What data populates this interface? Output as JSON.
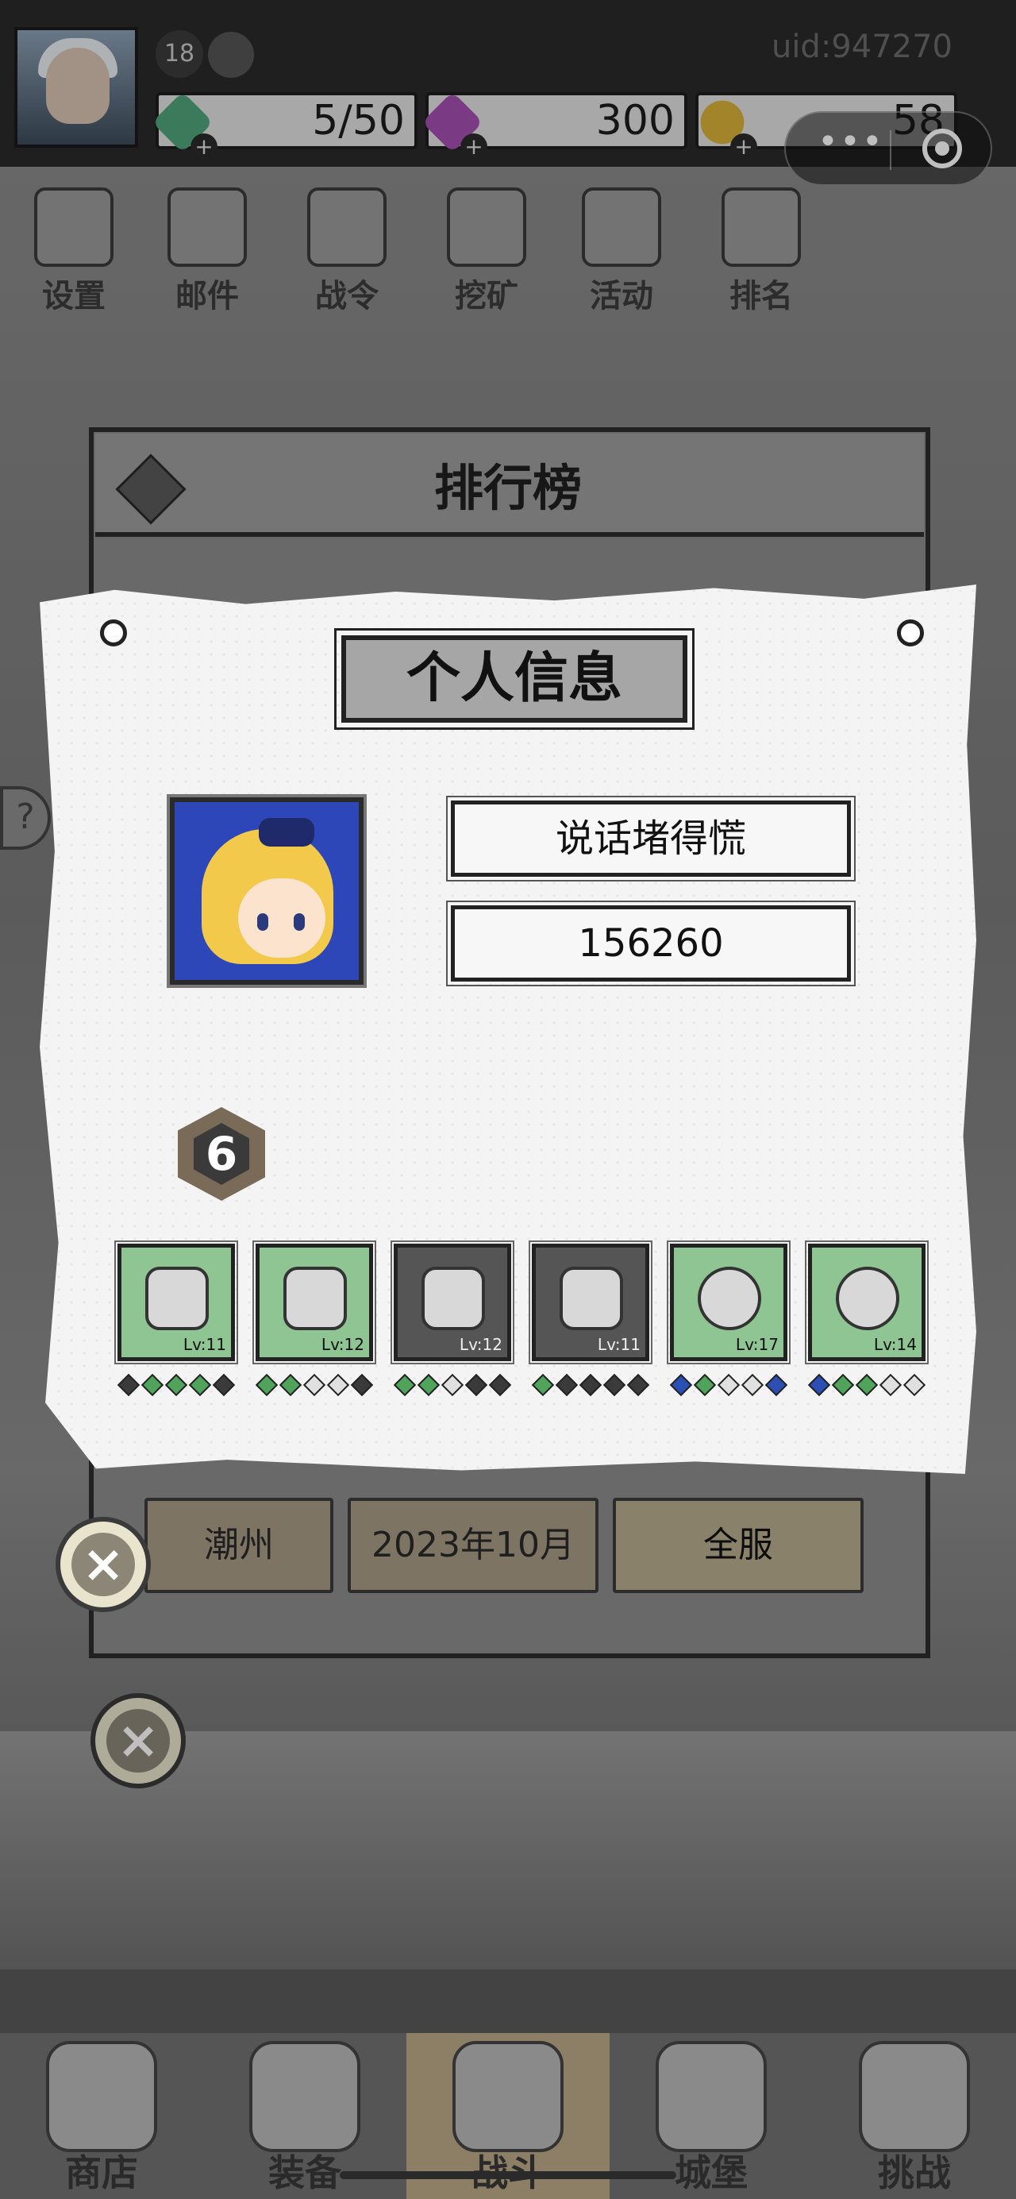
{
  "header": {
    "uid": "uid:947270",
    "level": "18",
    "resources": [
      {
        "name": "stamina",
        "value": "5/50",
        "color": "#4fa37a"
      },
      {
        "name": "gems",
        "value": "300",
        "color": "#a34fb0"
      },
      {
        "name": "gold",
        "value": "58",
        "color": "#d9b23a"
      }
    ]
  },
  "menu": [
    {
      "label": "设置",
      "icon": "gear-icon"
    },
    {
      "label": "邮件",
      "icon": "mail-icon"
    },
    {
      "label": "战令",
      "icon": "battle-pass-icon"
    },
    {
      "label": "挖矿",
      "icon": "mining-icon"
    },
    {
      "label": "活动",
      "icon": "event-icon"
    },
    {
      "label": "排名",
      "icon": "ranking-icon"
    }
  ],
  "ranking": {
    "title": "排行榜",
    "filters": [
      "潮州",
      "2023年10月",
      "全服"
    ],
    "selected_filter": "全服"
  },
  "card": {
    "title": "个人信息",
    "player_name": "说话堵得慌",
    "power": "156260",
    "rank_level": "6",
    "equipment": [
      {
        "slot": "helmet",
        "level": "Lv:11",
        "quality": "green",
        "stars": [
          "d",
          "g",
          "g",
          "g",
          "d"
        ]
      },
      {
        "slot": "armor",
        "level": "Lv:12",
        "quality": "green",
        "stars": [
          "g",
          "g",
          "w",
          "w",
          "d"
        ]
      },
      {
        "slot": "boots",
        "level": "Lv:12",
        "quality": "gray",
        "stars": [
          "g",
          "g",
          "w",
          "d",
          "d"
        ]
      },
      {
        "slot": "weapon",
        "level": "Lv:11",
        "quality": "gray",
        "stars": [
          "g",
          "d",
          "d",
          "d",
          "d"
        ]
      },
      {
        "slot": "ring",
        "level": "Lv:17",
        "quality": "green",
        "stars": [
          "b",
          "g",
          "w",
          "w",
          "b"
        ]
      },
      {
        "slot": "necklace",
        "level": "Lv:14",
        "quality": "green",
        "stars": [
          "b",
          "g",
          "g",
          "w",
          "w"
        ]
      }
    ]
  },
  "nav": [
    {
      "label": "商店",
      "icon": "shop-icon"
    },
    {
      "label": "装备",
      "icon": "backpack-icon"
    },
    {
      "label": "战斗",
      "icon": "crossed-swords-icon",
      "active": true
    },
    {
      "label": "城堡",
      "icon": "castle-icon"
    },
    {
      "label": "挑战",
      "icon": "shield-icon"
    }
  ],
  "capsule": {
    "more": "•••"
  }
}
